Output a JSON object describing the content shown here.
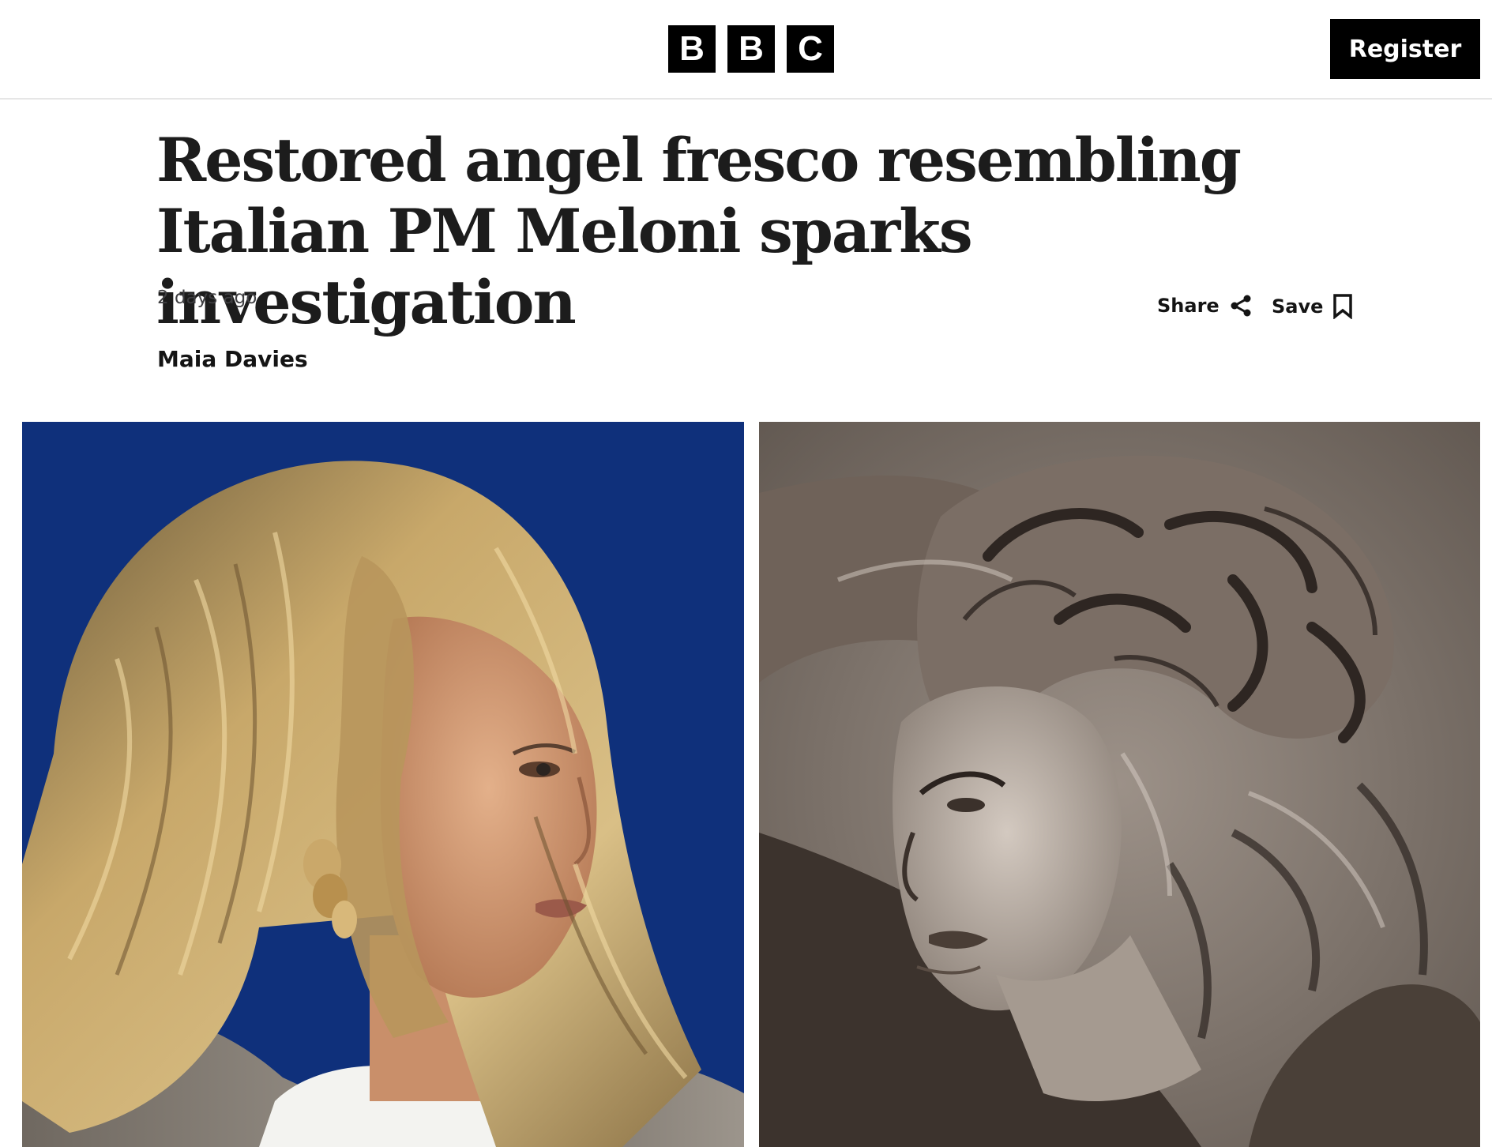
{
  "header": {
    "logo": [
      "B",
      "B",
      "C"
    ],
    "register_label": "Register"
  },
  "article": {
    "headline": "Restored angel fresco resembling Italian PM Meloni sparks investigation",
    "timestamp": "2 days ago",
    "author": "Maia Davies"
  },
  "actions": {
    "share_label": "Share",
    "save_label": "Save"
  },
  "colors": {
    "brand_black": "#000000",
    "text": "#141414",
    "photo_background_blue": "#0f2f7a",
    "fresco_tone": "#6e6258"
  },
  "icons": {
    "share": "share-icon",
    "save": "bookmark-icon"
  }
}
